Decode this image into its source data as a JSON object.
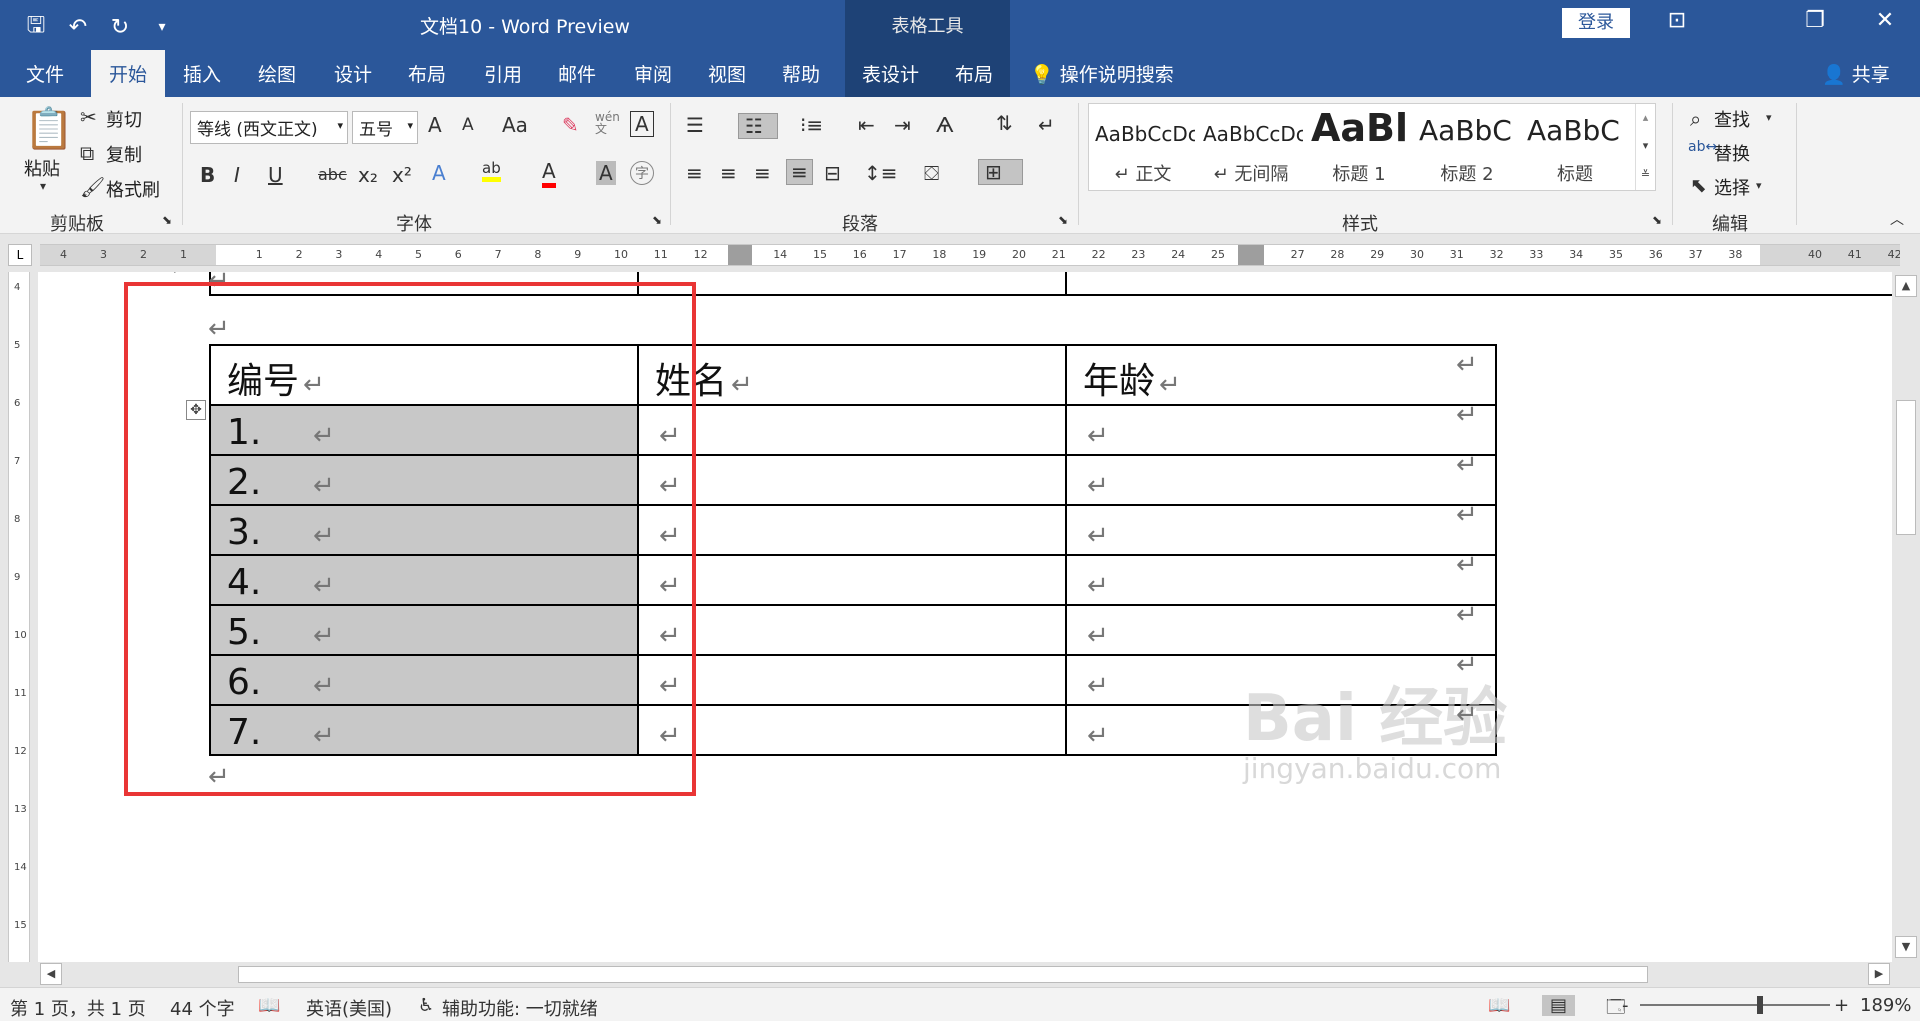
{
  "titlebar": {
    "title": "文档10  -  Word Preview",
    "context_tools": "表格工具",
    "login": "登录",
    "qat_icons": [
      "save-icon",
      "undo-icon",
      "redo-icon",
      "customize-qat-icon"
    ],
    "window_controls": [
      "ribbon-display-icon",
      "restore-icon",
      "close-icon"
    ]
  },
  "tabs": {
    "file": "文件",
    "home": "开始",
    "insert": "插入",
    "draw": "绘图",
    "design": "设计",
    "layout": "布局",
    "references": "引用",
    "mailings": "邮件",
    "review": "审阅",
    "view": "视图",
    "help": "帮助",
    "table_design": "表设计",
    "table_layout": "布局",
    "tell_me": "操作说明搜索",
    "share": "共享"
  },
  "clipboard": {
    "paste": "粘贴",
    "cut": "剪切",
    "copy": "复制",
    "format_painter": "格式刷",
    "label": "剪贴板"
  },
  "font": {
    "name": "等线 (西文正文)",
    "size": "五号",
    "label": "字体",
    "grow_glyph": "A",
    "shrink_glyph": "A",
    "case_glyph": "Aa",
    "bold": "B",
    "italic": "I",
    "underline": "U",
    "strike": "abc",
    "sub": "x₂",
    "sup": "x²",
    "phonetic": "wén文",
    "char_border": "A",
    "font_color": "A",
    "highlight": "ab",
    "char_shade": "A",
    "enclose": "字"
  },
  "paragraph": {
    "label": "段落"
  },
  "styles": {
    "label": "样式",
    "items": [
      {
        "sample": "AaBbCcDc",
        "name": "↵ 正文"
      },
      {
        "sample": "AaBbCcDc",
        "name": "↵ 无间隔"
      },
      {
        "sample": "AaBl",
        "name": "标题 1"
      },
      {
        "sample": "AaBbC",
        "name": "标题 2"
      },
      {
        "sample": "AaBbC",
        "name": "标题"
      }
    ]
  },
  "editing": {
    "label": "编辑",
    "find": "查找",
    "replace": "替换",
    "select": "选择"
  },
  "ruler": {
    "left_numbers": [
      "4",
      "3",
      "2",
      "1"
    ],
    "right_numbers": [
      "1",
      "2",
      "3",
      "4",
      "5",
      "6",
      "7",
      "8",
      "9",
      "10",
      "11",
      "12",
      "14",
      "15",
      "16",
      "17",
      "18",
      "19",
      "20",
      "21",
      "22",
      "23",
      "24",
      "25",
      "27",
      "28",
      "29",
      "30",
      "31",
      "32",
      "33",
      "34",
      "35",
      "36",
      "37",
      "38",
      "40",
      "41",
      "42"
    ],
    "vertical_numbers": [
      "4",
      "5",
      "6",
      "7",
      "8",
      "9",
      "10",
      "11",
      "12",
      "13",
      "14",
      "15"
    ]
  },
  "document": {
    "para_mark": "↵",
    "headers": [
      "编号",
      "姓名",
      "年龄"
    ],
    "rows": [
      "1.",
      "2.",
      "3.",
      "4.",
      "5.",
      "6.",
      "7."
    ],
    "watermark": "Bai 经验",
    "watermark_url": "jingyan.baidu.com"
  },
  "status": {
    "page": "第 1 页，共 1 页",
    "words": "44 个字",
    "language": "英语(美国)",
    "accessibility": "辅助功能: 一切就绪",
    "zoom": "189%",
    "zoom_minus": "-",
    "zoom_plus": "+"
  },
  "colors": {
    "accent": "#2b579a",
    "selection": "#c8c8c8",
    "annotation": "#e93535",
    "highlight": "#ffff00",
    "font_color": "#ff0000"
  }
}
